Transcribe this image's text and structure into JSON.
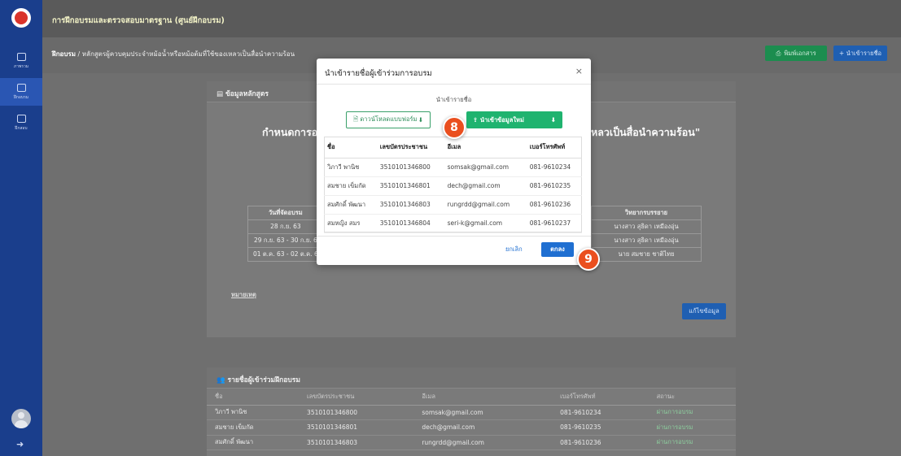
{
  "app": {
    "title": "การฝึกอบรมและตรวจสอบมาตรฐาน (ศูนย์ฝึกอบรม)"
  },
  "sidebar": {
    "items": [
      {
        "label": "ภาพรวม"
      },
      {
        "label": "ฝึกอบรม"
      },
      {
        "label": "ฝึกสอบ"
      }
    ]
  },
  "breadcrumb": {
    "root": "ฝึกอบรม",
    "path": " / หลักสูตรผู้ควบคุมประจำหม้อน้ำหรือหม้อต้มที่ใช้ของเหลวเป็นสื่อนำความร้อน"
  },
  "header_buttons": {
    "print": "พิมพ์เอกสาร",
    "import": "+ นำเข้ารายชื่อ"
  },
  "course_card": {
    "header": "ข้อมูลหลักสูตร",
    "heading_left": "กำหนดการอบ",
    "heading_right": "หลวเป็นสื่อนำความร้อน\"",
    "schedule": {
      "col_date": "วันที่จัดอบรม",
      "col_lecturer": "วิทยากรบรรยาย",
      "rows": [
        {
          "date": "28 ก.ย. 63",
          "lecturer": "นางสาว สุธิดา เหมืองอุ่น"
        },
        {
          "date": "29 ก.ย. 63 - 30 ก.ย. 6",
          "lecturer": "นางสาว สุธิดา เหมืองอุ่น"
        },
        {
          "date": "01 ต.ค. 63 - 02 ต.ค. 6",
          "lecturer": "นาย สมชาย ชาติไทย"
        }
      ]
    },
    "note": "หมายเหตุ",
    "edit": "แก้ไขข้อมูล"
  },
  "participants": {
    "header": "รายชื่อผู้เข้าร่วมฝึกอบรม",
    "columns": [
      "ชื่อ",
      "เลขบัตรประชาชน",
      "อีเมล",
      "เบอร์โทรศัพท์",
      "สถานะ"
    ],
    "rows": [
      {
        "name": "วิภาวี พานิช",
        "id": "3510101346800",
        "email": "somsak@gmail.com",
        "phone": "081-9610234",
        "status": "ผ่านการอบรม"
      },
      {
        "name": "สมชาย เข็มกัด",
        "id": "3510101346801",
        "email": "dech@gmail.com",
        "phone": "081-9610235",
        "status": "ผ่านการอบรม"
      },
      {
        "name": "สมศักดิ์ พัฒนา",
        "id": "3510101346803",
        "email": "rungrdd@gmail.com",
        "phone": "081-9610236",
        "status": "ผ่านการอบรม"
      }
    ]
  },
  "modal": {
    "title": "นำเข้ารายชื่อผู้เข้าร่วมการอบรม",
    "close": "×",
    "subtitle": "นำเข้ารายชื่อ",
    "download_template": "ดาวน์โหลดแบบฟอร์ม",
    "import_new": "นำเข้าข้อมูลใหม่",
    "columns": [
      "ชื่อ",
      "เลขบัตรประชาชน",
      "อีเมล",
      "เบอร์โทรศัพท์"
    ],
    "rows": [
      {
        "name": "วิภาวี พานิช",
        "id": "3510101346800",
        "email": "somsak@gmail.com",
        "phone": "081-9610234"
      },
      {
        "name": "สมชาย เข็มกัด",
        "id": "3510101346801",
        "email": "dech@gmail.com",
        "phone": "081-9610235"
      },
      {
        "name": "สมศักดิ์ พัฒนา",
        "id": "3510101346803",
        "email": "rungrdd@gmail.com",
        "phone": "081-9610236"
      },
      {
        "name": "สมหญิง สมร",
        "id": "3510101346804",
        "email": "seri-k@gmail.com",
        "phone": "081-9610237"
      }
    ],
    "cancel": "ยกเลิก",
    "ok": "ตกลง"
  },
  "steps": {
    "step8": "8",
    "step9": "9"
  }
}
